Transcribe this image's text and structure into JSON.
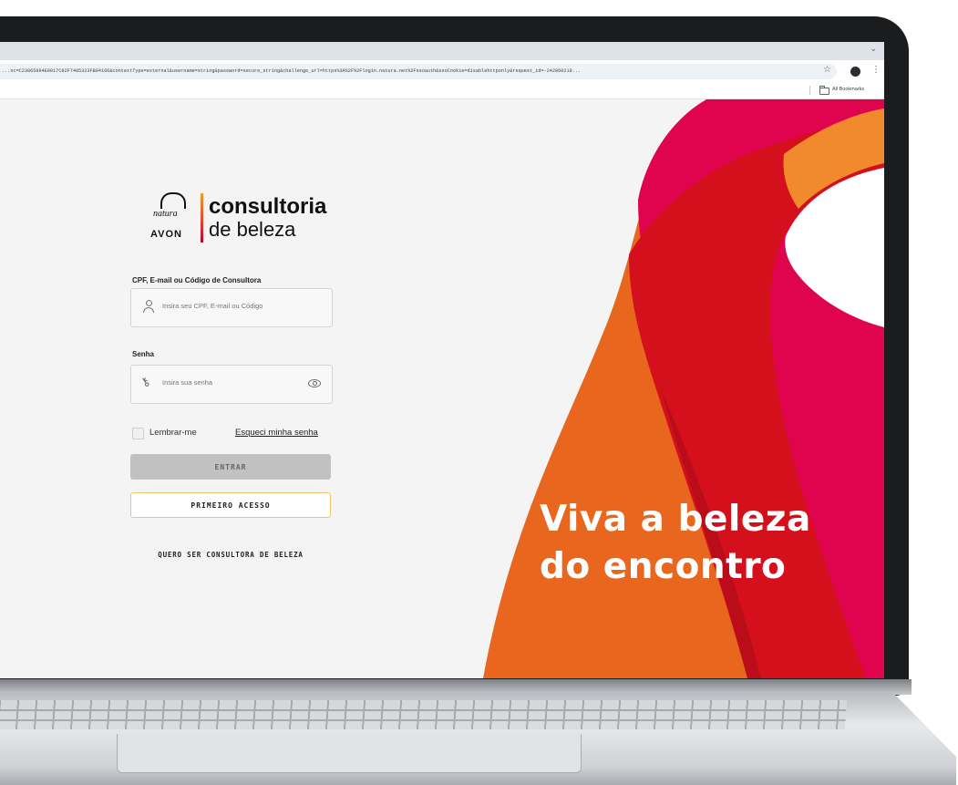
{
  "browser": {
    "url": "...nc=C23865894E9817C82F7485323FB04166&contextType=external&username=string&password=secure_string&challenge_url=https%3A%2F%2Flogin.natura.net%2Fssoauth&ssoCookie=disablehttponly&request_id=-242860218...",
    "bookmarks_label": "All Bookmarks"
  },
  "logo": {
    "natura": "natura",
    "avon": "AVON",
    "line1": "consultoria",
    "line2": "de beleza"
  },
  "form": {
    "login_label": "CPF, E-mail ou Código de Consultora",
    "login_placeholder": "Insira seu CPF, E-mail ou Código",
    "password_label": "Senha",
    "password_placeholder": "Insira sua senha",
    "remember_label": "Lembrar-me",
    "forgot_link": "Esqueci minha senha",
    "login_button": "ENTRAR",
    "first_access_button": "PRIMEIRO ACESSO",
    "become_consultant_link": "QUERO SER CONSULTORA DE BELEZA"
  },
  "hero": {
    "slogan_line1": "Viva a beleza",
    "slogan_line2": "do encontro"
  },
  "colors": {
    "orange": "#e8661e",
    "red": "#d3101c",
    "magenta": "#e0044f",
    "deep_red": "#a80a1a",
    "light_orange": "#f08a2c"
  }
}
